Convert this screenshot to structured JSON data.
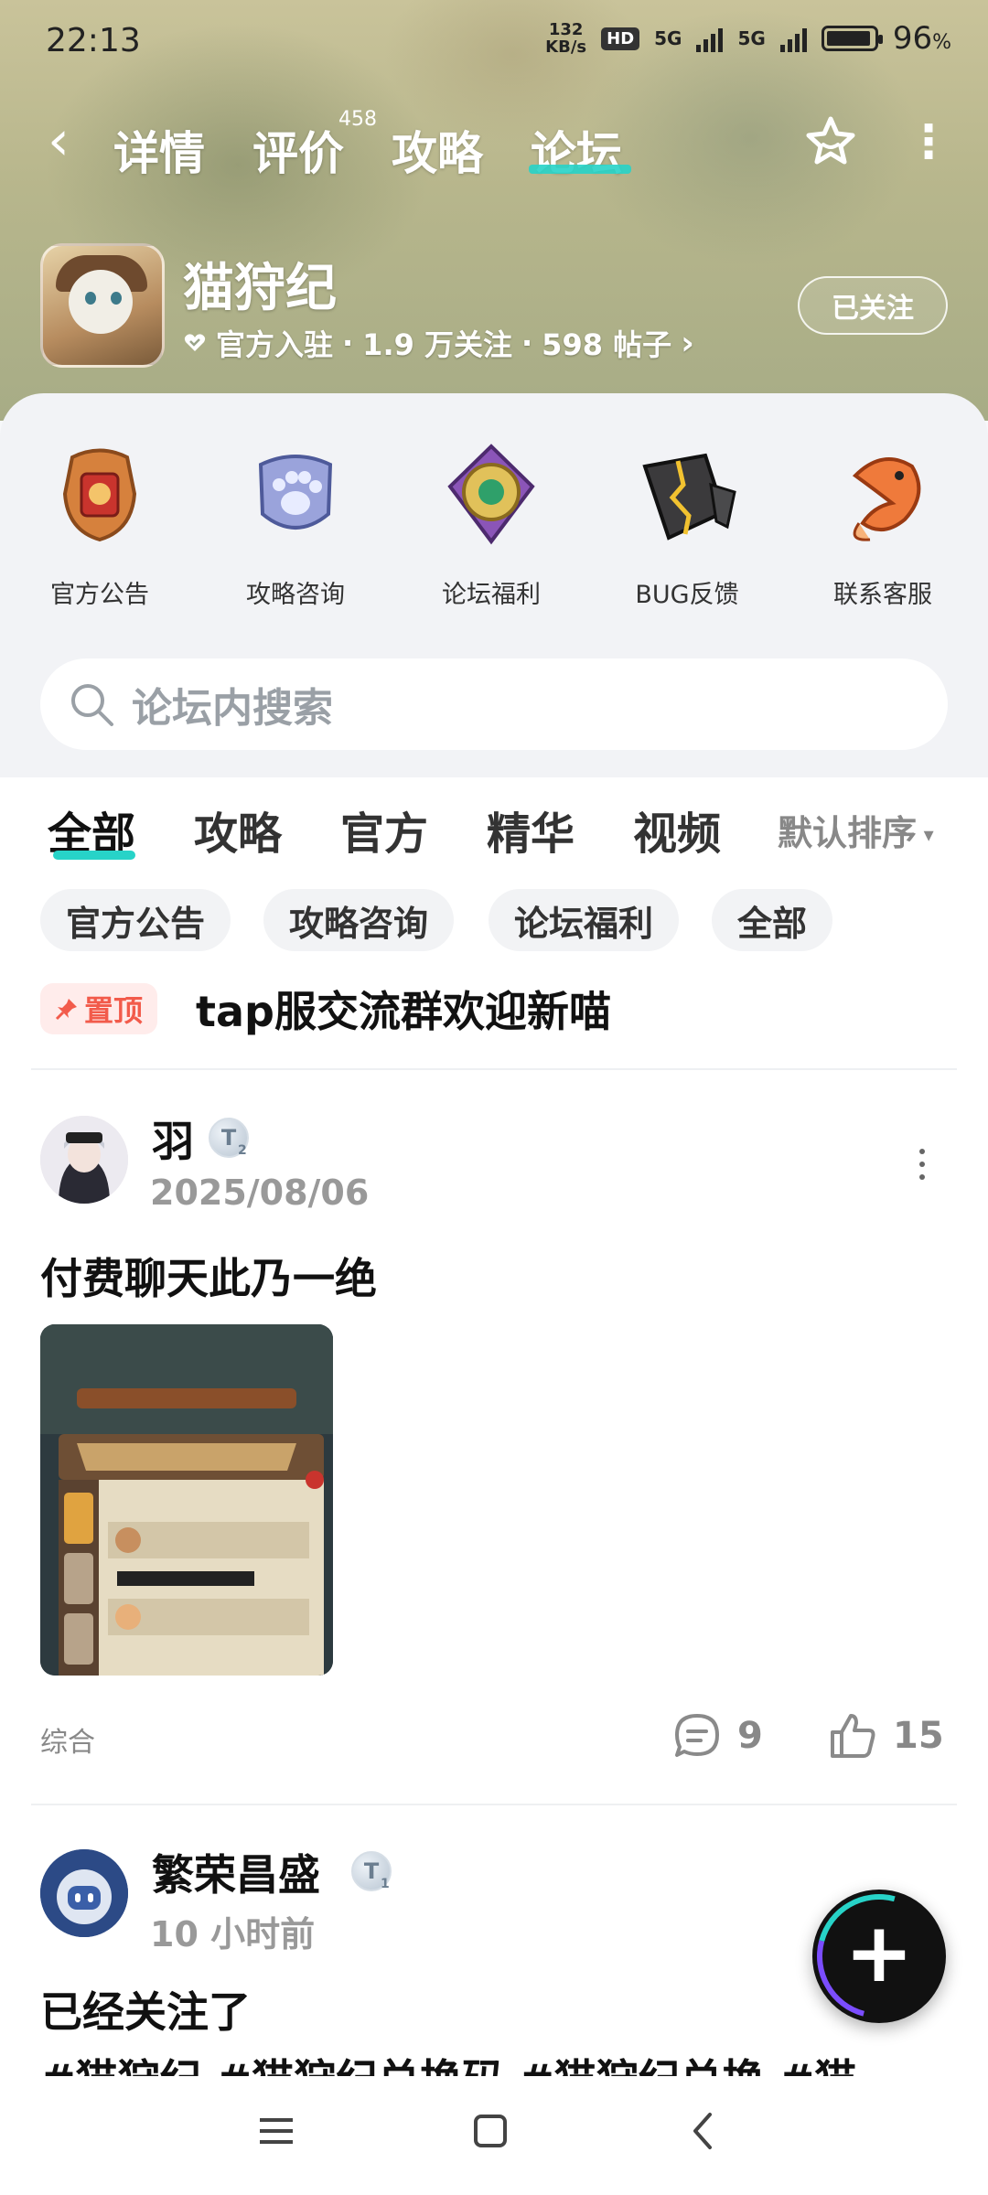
{
  "status_bar": {
    "time": "22:13",
    "speed_value": "132",
    "speed_unit": "KB/s",
    "hd": "HD",
    "net1": "5G",
    "net2": "5G",
    "battery": "96",
    "battery_unit": "%"
  },
  "nav": {
    "tabs": [
      "详情",
      "评价",
      "攻略",
      "论坛"
    ],
    "review_count": "458",
    "active_tab": "论坛"
  },
  "game": {
    "title": "猫狩纪",
    "meta": [
      "官方入驻",
      "1.9 万关注",
      "598 帖子"
    ],
    "follow_label": "已关注"
  },
  "categories": [
    "官方公告",
    "攻略咨询",
    "论坛福利",
    "BUG反馈",
    "联系客服"
  ],
  "search": {
    "placeholder": "论坛内搜索"
  },
  "filter_tabs": [
    "全部",
    "攻略",
    "官方",
    "精华",
    "视频"
  ],
  "sort_label": "默认排序",
  "chips": [
    "官方公告",
    "攻略咨询",
    "论坛福利",
    "全部"
  ],
  "pinned": {
    "label": "置顶",
    "title": "tap服交流群欢迎新喵"
  },
  "posts": [
    {
      "user": "羽",
      "level": "2",
      "date": "2025/08/06",
      "text": "付费聊天此乃一绝",
      "tag": "综合",
      "comments": "9",
      "likes": "15"
    },
    {
      "user": "繁荣昌盛",
      "level": "1",
      "date": "10 小时前",
      "text": "已经关注了",
      "hashtags": "#猫狩纪 #猫狩纪兑换码 #猫狩纪兑换 #猫"
    }
  ],
  "colors": {
    "accent": "#27d3c8",
    "pin_red": "#f25b4b"
  }
}
